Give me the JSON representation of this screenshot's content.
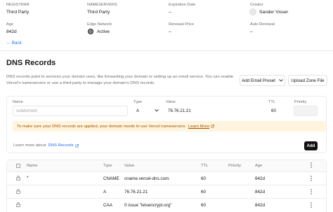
{
  "overview": {
    "registrar": {
      "label": "REGISTRAR",
      "value": "Third Party"
    },
    "nameservers": {
      "label": "NAMESERVERS",
      "value": "Third Party"
    },
    "expiration": {
      "label": "Expiration Date",
      "value": "–"
    },
    "creator": {
      "label": "Creator",
      "value": "Sander Visser"
    },
    "age": {
      "label": "Age",
      "value": "842d"
    },
    "edge_network": {
      "label": "Edge Network",
      "value": "Active"
    },
    "renewal_price": {
      "label": "Renewal Price",
      "value": "–"
    },
    "auto_renewal": {
      "label": "Auto Renewal",
      "value": "–"
    }
  },
  "back_link": "← Back",
  "dns": {
    "title": "DNS Records",
    "description_line1": "DNS records point to services your domain uses, like forwarding your domain or setting up an email service. You can enable",
    "description_line2": "Vercel's nameservers or use a third-party to manage your domain's DNS records.",
    "add_email_preset_label": "Add Email Preset",
    "upload_zone_file_label": "Upload Zone File",
    "form": {
      "name_label": "Name",
      "name_placeholder": "subdomain",
      "type_label": "Type",
      "type_value": "A",
      "value_label": "Value",
      "value_value": "76.76.21.21",
      "ttl_label": "TTL",
      "ttl_value": "60",
      "priority_label": "Priority"
    },
    "notice_text": "To make sure your DNS records are applied, your domain needs to use Vercel nameservers.",
    "notice_link": "Learn More",
    "learn_more_prefix": "Learn more about",
    "learn_more_link": "DNS Records",
    "add_button": "Add",
    "table": {
      "headers": [
        "Name",
        "Type",
        "Value",
        "TTL",
        "Priority",
        "Age"
      ],
      "rows": [
        {
          "name": "*",
          "type": "CNAME",
          "value": "cname.vercel-dns.com.",
          "ttl": "60",
          "priority": "",
          "age": "842d"
        },
        {
          "name": "",
          "type": "A",
          "value": "76.76.21.21",
          "ttl": "60",
          "priority": "",
          "age": "842d"
        },
        {
          "name": "",
          "type": "CAA",
          "value": "0 issue \"letsencrypt.org\"",
          "ttl": "60",
          "priority": "",
          "age": "842d"
        }
      ]
    }
  },
  "colors": {
    "accent": "#1f6feb",
    "active": "#1a1a1a",
    "notice_bg": "#fff4de",
    "notice_text": "#a35200",
    "dark_button": "#111111"
  },
  "icons": [
    "globe-icon",
    "avatar",
    "chevron-down-icon",
    "external-link-icon",
    "lock-icon",
    "more-vertical-icon",
    "checkbox"
  ]
}
